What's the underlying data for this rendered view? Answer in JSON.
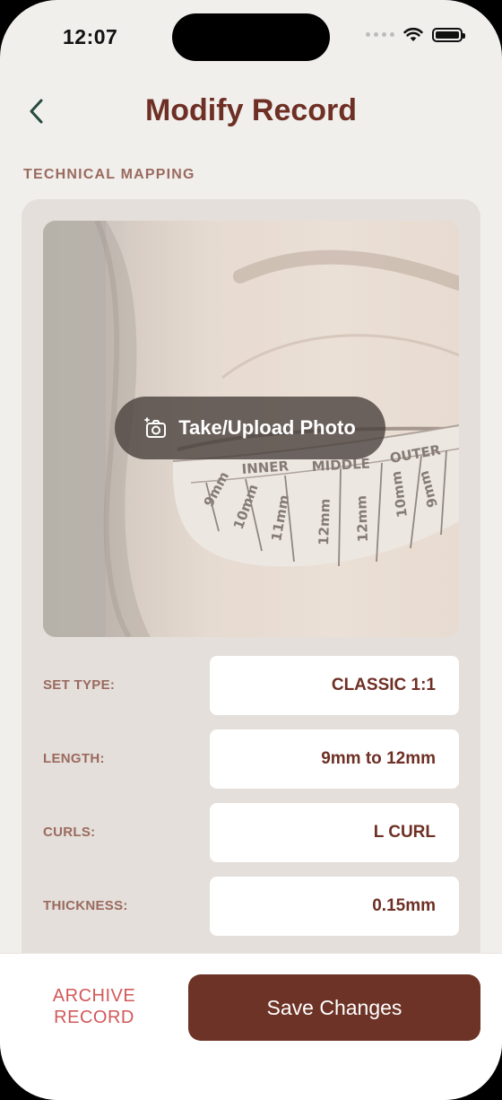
{
  "status": {
    "time": "12:07"
  },
  "header": {
    "title": "Modify Record"
  },
  "section": {
    "label": "TECHNICAL MAPPING"
  },
  "photo": {
    "button_label": "Take/Upload Photo",
    "zones": [
      "INNER",
      "MIDDLE",
      "OUTER"
    ],
    "lengths": [
      "9mm",
      "10mm",
      "11mm",
      "12mm",
      "12mm",
      "10mm",
      "9mm"
    ]
  },
  "fields": [
    {
      "label": "SET TYPE:",
      "value": "CLASSIC 1:1"
    },
    {
      "label": "LENGTH:",
      "value": "9mm to 12mm"
    },
    {
      "label": "CURLS:",
      "value": "L CURL"
    },
    {
      "label": "THICKNESS:",
      "value": "0.15mm"
    }
  ],
  "footer": {
    "archive_label": "ARCHIVE RECORD",
    "save_label": "Save Changes"
  },
  "colors": {
    "accent": "#6e2f24",
    "danger": "#d2585a",
    "background": "#f1efec",
    "card": "#e4dfda"
  }
}
